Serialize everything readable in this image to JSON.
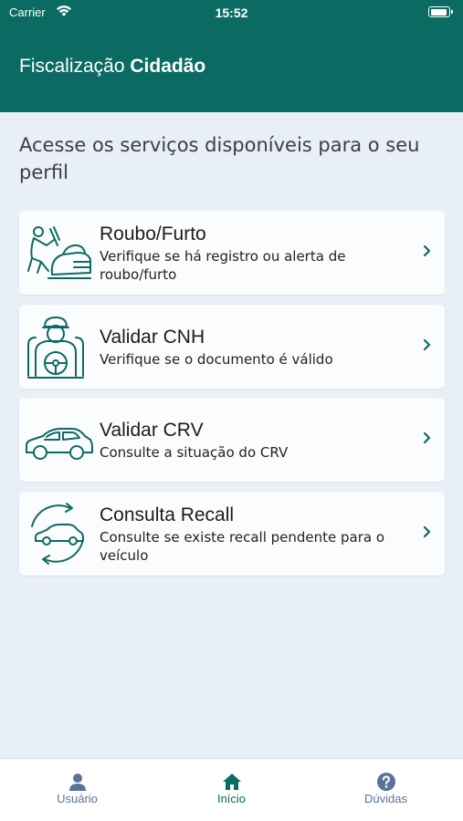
{
  "status_bar": {
    "carrier": "Carrier",
    "time": "15:52",
    "battery_level": 0.9
  },
  "header": {
    "title_regular": "Fiscalização",
    "title_bold": "Cidadão"
  },
  "intro": "Acesse os serviços disponíveis para o seu perfil",
  "services": [
    {
      "title": "Roubo/Furto",
      "description": "Verifique se há registro ou alerta de roubo/furto",
      "icon": "theft-icon"
    },
    {
      "title": "Validar CNH",
      "description": "Verifique se o documento é válido",
      "icon": "driver-icon"
    },
    {
      "title": "Validar CRV",
      "description": "Consulte a situação do CRV",
      "icon": "car-icon"
    },
    {
      "title": "Consulta Recall",
      "description": "Consulte se existe recall pendente para o veículo",
      "icon": "car-recall-icon"
    }
  ],
  "tabs": [
    {
      "label": "Usuário",
      "icon": "user-icon",
      "active": false
    },
    {
      "label": "Início",
      "icon": "home-icon",
      "active": true
    },
    {
      "label": "Dúvidas",
      "icon": "question-icon",
      "active": false
    }
  ],
  "colors": {
    "primary": "#0b6b62",
    "background": "#e9eff6",
    "inactive_tab": "#5a7499"
  }
}
